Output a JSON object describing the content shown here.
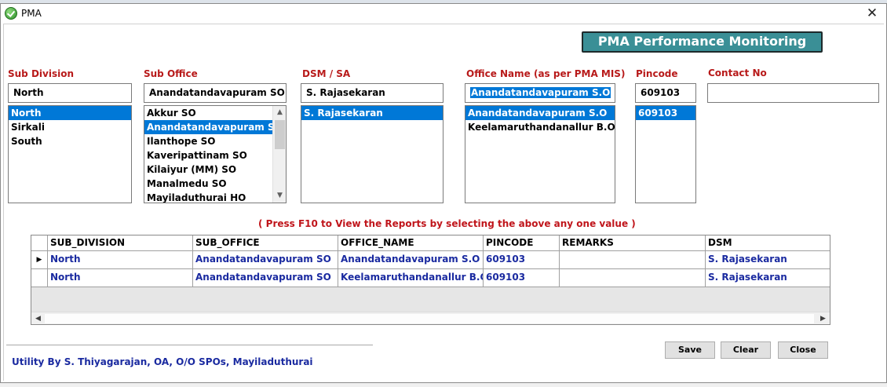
{
  "window": {
    "title": "PMA"
  },
  "banner": {
    "title": "PMA Performance  Monitoring"
  },
  "fields": {
    "sub_division": {
      "label": "Sub Division",
      "value": "North",
      "options": [
        "North",
        "Sirkali",
        "South"
      ]
    },
    "sub_office": {
      "label": "Sub Office",
      "value": "Anandatandavapuram SO",
      "options": [
        "Akkur SO",
        "Anandatandavapuram SO",
        "Ilanthope SO",
        "Kaveripattinam SO",
        "Kilaiyur (MM) SO",
        "Manalmedu SO",
        "Mayiladuthurai HO"
      ]
    },
    "dsm_sa": {
      "label": "DSM / SA",
      "value": "S. Rajasekaran",
      "options": [
        "S. Rajasekaran"
      ]
    },
    "office_name": {
      "label": "Office Name (as per PMA MIS)",
      "value": "Anandatandavapuram S.O",
      "options": [
        "Anandatandavapuram S.O",
        "Keelamaruthandanallur B.O"
      ]
    },
    "pincode": {
      "label": "Pincode",
      "value": "609103",
      "options": [
        "609103"
      ]
    },
    "contact_no": {
      "label": "Contact No",
      "value": ""
    }
  },
  "hint": "( Press F10 to View the Reports by selecting the above any one value )",
  "grid": {
    "columns": [
      "SUB_DIVISION",
      "SUB_OFFICE",
      "OFFICE_NAME",
      "PINCODE",
      "REMARKS",
      "DSM"
    ],
    "rows": [
      [
        "North",
        "Anandatandavapuram SO",
        "Anandatandavapuram S.O",
        "609103",
        "",
        "S. Rajasekaran"
      ],
      [
        "North",
        "Anandatandavapuram SO",
        "Keelamaruthandanallur B.O",
        "609103",
        "",
        "S. Rajasekaran"
      ]
    ]
  },
  "footer": "Utility By S. Thiyagarajan, OA, O/O SPOs, Mayiladuthurai",
  "buttons": {
    "save": "Save",
    "clear": "Clear",
    "close": "Close"
  },
  "colors": {
    "banner_bg": "#3a8f96",
    "label_red": "#b81a1a",
    "selection": "#0078d7",
    "data_blue": "#1a2aa0"
  }
}
